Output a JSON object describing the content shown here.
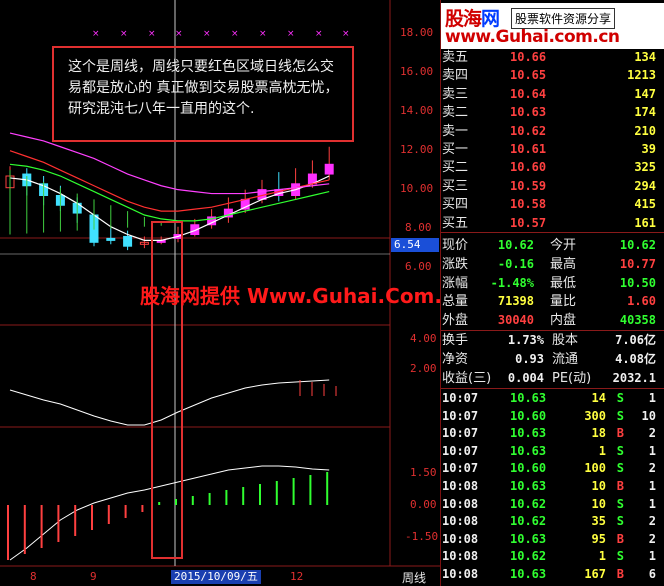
{
  "logo": {
    "brand_a": "股海",
    "brand_b": "网",
    "box": "股票软件资源分享",
    "url": "www.Guhai.com.cn"
  },
  "annotation": {
    "text": "这个是周线，周线只要红色区域日线怎么交易都是放心的 真正做到交易股票高枕无忧，研究混沌七八年一直用的这个."
  },
  "watermark": "股海网提供 Www.Guhai.Com.CN",
  "axis": {
    "main_ticks": [
      "18.00",
      "16.00",
      "14.00",
      "12.00",
      "10.00",
      "8.00",
      "6.00"
    ],
    "mid_ticks": [
      "4.00",
      "2.00"
    ],
    "lower_ticks": [
      "1.50",
      "0.00",
      "-1.50"
    ],
    "price_tag": "6.54",
    "x_ticks": [
      "8",
      "9",
      "12"
    ],
    "date_tag": "2015/10/09/五",
    "period": "周线"
  },
  "asks": [
    {
      "label": "卖五",
      "price": "10.66",
      "vol": "134"
    },
    {
      "label": "卖四",
      "price": "10.65",
      "vol": "1213"
    },
    {
      "label": "卖三",
      "price": "10.64",
      "vol": "147"
    },
    {
      "label": "卖二",
      "price": "10.63",
      "vol": "174"
    },
    {
      "label": "卖一",
      "price": "10.62",
      "vol": "210"
    }
  ],
  "bids": [
    {
      "label": "买一",
      "price": "10.61",
      "vol": "39"
    },
    {
      "label": "买二",
      "price": "10.60",
      "vol": "325"
    },
    {
      "label": "买三",
      "price": "10.59",
      "vol": "294"
    },
    {
      "label": "买四",
      "price": "10.58",
      "vol": "415"
    },
    {
      "label": "买五",
      "price": "10.57",
      "vol": "161"
    }
  ],
  "quote": [
    {
      "l1": "现价",
      "v1": "10.62",
      "l2": "今开",
      "v2": "10.62",
      "c1": "green",
      "c2": "green"
    },
    {
      "l1": "涨跌",
      "v1": "-0.16",
      "l2": "最高",
      "v2": "10.77",
      "c1": "green",
      "c2": "red"
    },
    {
      "l1": "涨幅",
      "v1": "-1.48%",
      "l2": "最低",
      "v2": "10.50",
      "c1": "green",
      "c2": "green"
    },
    {
      "l1": "总量",
      "v1": "71398",
      "l2": "量比",
      "v2": "1.60",
      "c1": "yellow",
      "c2": "red"
    },
    {
      "l1": "外盘",
      "v1": "30040",
      "l2": "内盘",
      "v2": "40358",
      "c1": "red",
      "c2": "green"
    }
  ],
  "finance": [
    {
      "l1": "换手",
      "v1": "1.73%",
      "l2": "股本",
      "v2": "7.06亿"
    },
    {
      "l1": "净资",
      "v1": "0.93",
      "l2": "流通",
      "v2": "4.08亿"
    },
    {
      "l1": "收益(三)",
      "v1": "0.004",
      "l2": "PE(动)",
      "v2": "2032.1"
    }
  ],
  "ticks": [
    {
      "time": "10:07",
      "price": "10.63",
      "vol": "14",
      "side": "S",
      "num": "1"
    },
    {
      "time": "10:07",
      "price": "10.60",
      "vol": "300",
      "side": "S",
      "num": "10"
    },
    {
      "time": "10:07",
      "price": "10.63",
      "vol": "18",
      "side": "B",
      "num": "2"
    },
    {
      "time": "10:07",
      "price": "10.63",
      "vol": "1",
      "side": "S",
      "num": "1"
    },
    {
      "time": "10:07",
      "price": "10.60",
      "vol": "100",
      "side": "S",
      "num": "2"
    },
    {
      "time": "10:08",
      "price": "10.63",
      "vol": "10",
      "side": "B",
      "num": "1"
    },
    {
      "time": "10:08",
      "price": "10.62",
      "vol": "10",
      "side": "S",
      "num": "1"
    },
    {
      "time": "10:08",
      "price": "10.62",
      "vol": "35",
      "side": "S",
      "num": "2"
    },
    {
      "time": "10:08",
      "price": "10.63",
      "vol": "95",
      "side": "B",
      "num": "2"
    },
    {
      "time": "10:08",
      "price": "10.62",
      "vol": "1",
      "side": "S",
      "num": "1"
    },
    {
      "time": "10:08",
      "price": "10.63",
      "vol": "167",
      "side": "B",
      "num": "6"
    }
  ],
  "colors": {
    "up": "#ff4040",
    "down": "#30ff30",
    "grid": "#8a1a1a",
    "magenta": "#ff30ff",
    "cyan": "#40e0ff"
  }
}
